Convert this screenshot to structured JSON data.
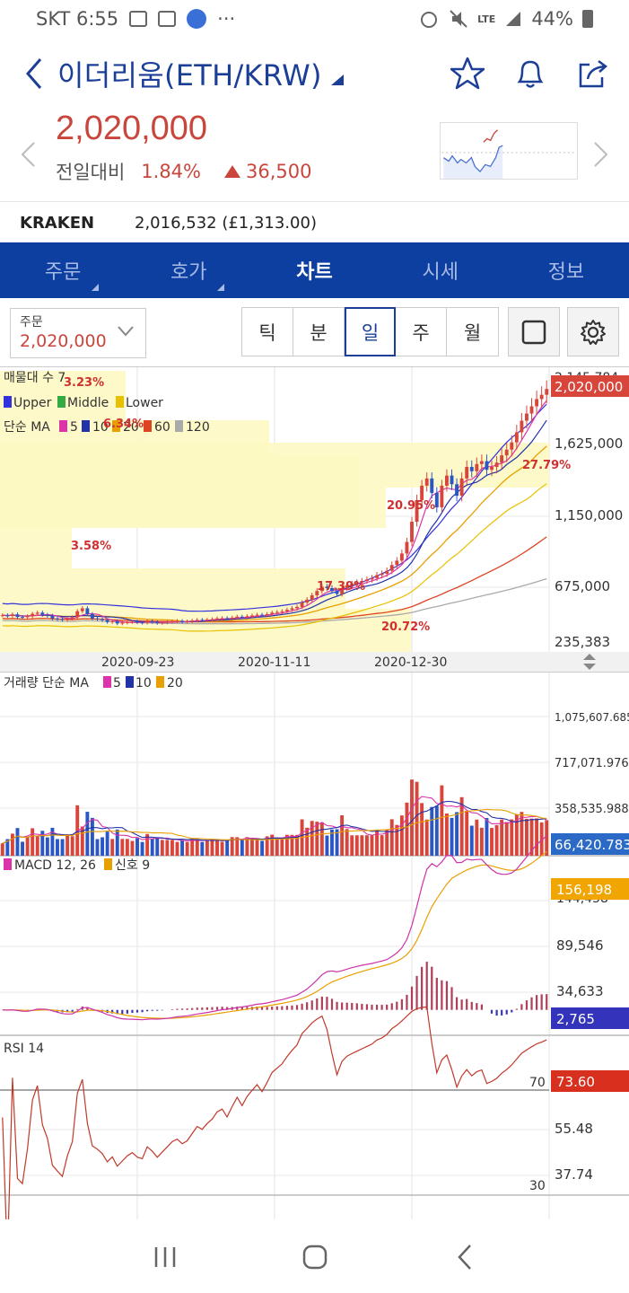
{
  "status_bar": {
    "carrier_time": "SKT 6:55",
    "more": "···",
    "network": "LTE",
    "battery": "44%"
  },
  "header": {
    "title": "이더리움(ETH/KRW)"
  },
  "price": {
    "value": "2,020,000",
    "change_label": "전일대비",
    "change_pct": "1.84%",
    "change_amount": "36,500"
  },
  "exchange": {
    "name": "KRAKEN",
    "price": "2,016,532 (£1,313.00)"
  },
  "nav": {
    "tabs": [
      {
        "label": "주문",
        "active": false,
        "has_corner": true
      },
      {
        "label": "호가",
        "active": false,
        "has_corner": true
      },
      {
        "label": "차트",
        "active": true,
        "has_corner": false
      },
      {
        "label": "시세",
        "active": false,
        "has_corner": false
      },
      {
        "label": "정보",
        "active": false,
        "has_corner": false
      }
    ]
  },
  "toolbar": {
    "order_label": "주문",
    "order_value": "2,020,000",
    "periods": [
      "틱",
      "분",
      "일",
      "주",
      "월"
    ],
    "active_period": "일"
  },
  "colors": {
    "up": "#c9463d",
    "nav_bg": "#0d3fa0",
    "accent": "#1b3f96",
    "volume_profile": "#fdf8c2"
  },
  "chart_data": [
    {
      "type": "candlestick",
      "panel": "price",
      "overlay_labels": {
        "volume_profile": "매물대 수 7",
        "bollinger": [
          "Upper",
          "Middle",
          "Lower"
        ],
        "ma_prefix": "단순 MA",
        "ma_periods": [
          "5",
          "10",
          "20",
          "60",
          "120"
        ]
      },
      "volume_profile_pcts": [
        "3.23%",
        "6.34%",
        "3.58%",
        "17.39%",
        "20.95%",
        "27.79%",
        "20.72%"
      ],
      "y_ticks": [
        "2,145,784",
        "1,625,000",
        "1,150,000",
        "675,000",
        "235,383"
      ],
      "current_price_label": "2,020,000",
      "x_ticks": [
        "2020-09-23",
        "2020-11-11",
        "2020-12-30"
      ],
      "close_series": [
        452000,
        447000,
        458000,
        440000,
        438000,
        445000,
        462000,
        470000,
        455000,
        448000,
        430000,
        425000,
        420000,
        430000,
        438000,
        480000,
        500000,
        460000,
        430000,
        425000,
        418000,
        405000,
        410000,
        395000,
        400000,
        405000,
        408000,
        402000,
        400000,
        410000,
        405000,
        398000,
        402000,
        406000,
        410000,
        412000,
        408000,
        410000,
        415000,
        420000,
        418000,
        422000,
        425000,
        430000,
        432000,
        428000,
        435000,
        442000,
        438000,
        445000,
        450000,
        455000,
        452000,
        460000,
        470000,
        475000,
        480000,
        490000,
        500000,
        510000,
        540000,
        560000,
        590000,
        620000,
        650000,
        640000,
        620000,
        600000,
        640000,
        660000,
        670000,
        680000,
        690000,
        700000,
        710000,
        730000,
        740000,
        760000,
        800000,
        830000,
        880000,
        960000,
        1100000,
        1250000,
        1350000,
        1400000,
        1300000,
        1200000,
        1350000,
        1420000,
        1360000,
        1280000,
        1400000,
        1480000,
        1450000,
        1500000,
        1520000,
        1460000,
        1480000,
        1510000,
        1560000,
        1600000,
        1650000,
        1720000,
        1800000,
        1850000,
        1900000,
        1950000,
        1980000,
        2020000
      ]
    },
    {
      "type": "bar",
      "panel": "volume",
      "label": "거래량 단순 MA",
      "ma_periods": [
        "5",
        "10",
        "20"
      ],
      "y_ticks": [
        "1,075,607.685",
        "717,071.976",
        "358,535.988"
      ],
      "current_label": "66,420.783"
    },
    {
      "type": "line",
      "panel": "macd",
      "label": "MACD 12, 26",
      "signal_label": "신호 9",
      "y_ticks": [
        "144,458",
        "89,546",
        "34,633"
      ],
      "current_macd": "156,198",
      "current_hist": "2,765"
    },
    {
      "type": "line",
      "panel": "rsi",
      "label": "RSI 14",
      "levels": [
        "70",
        "30"
      ],
      "y_ticks": [
        "55.48",
        "37.74"
      ],
      "current": "73.60"
    }
  ]
}
